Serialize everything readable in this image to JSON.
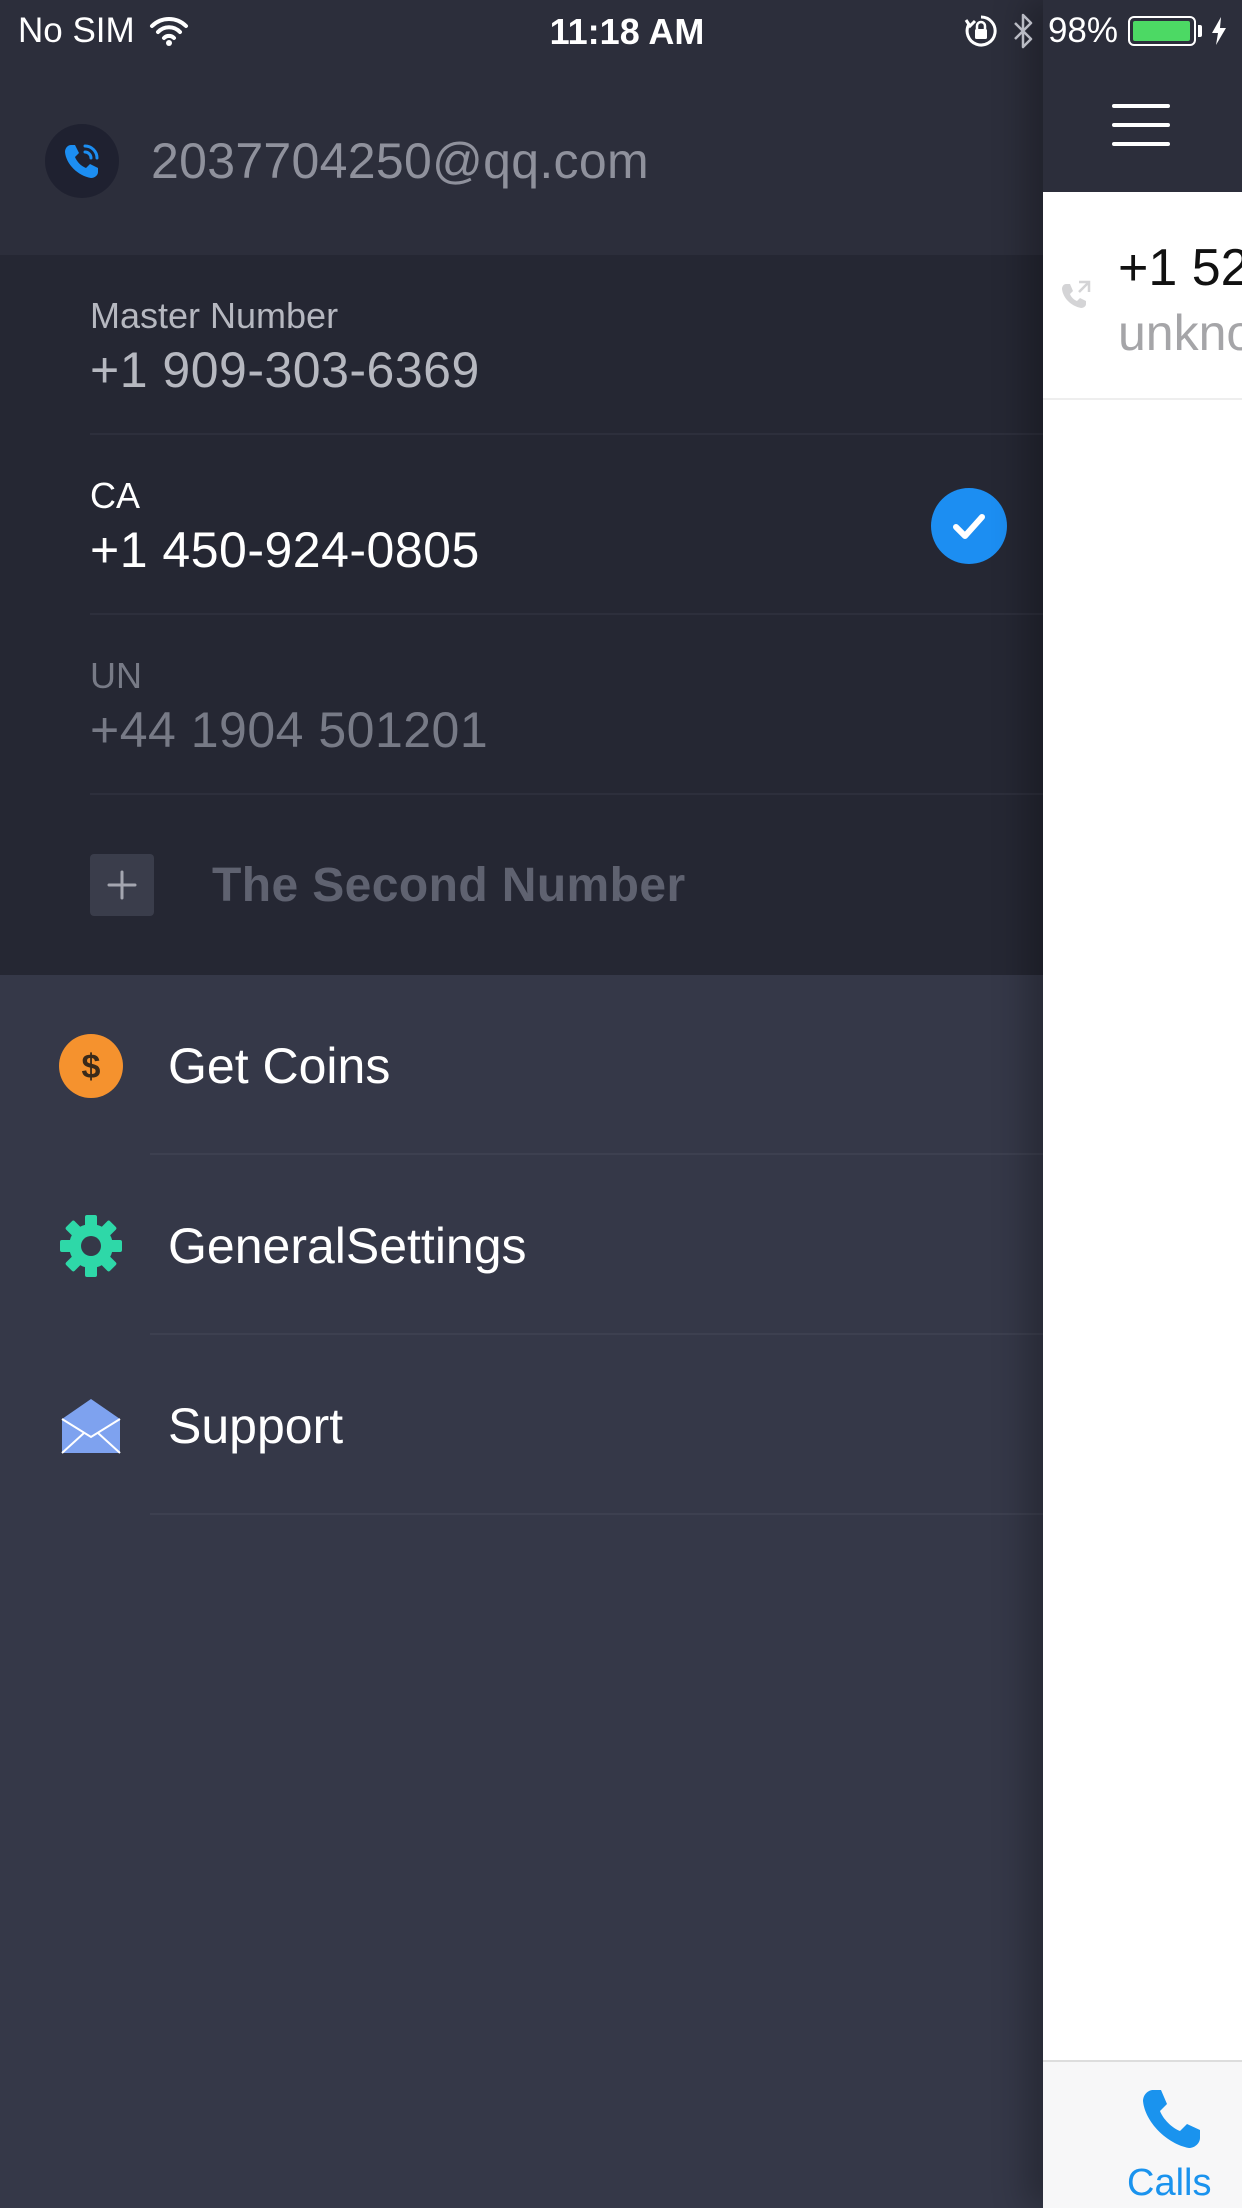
{
  "status_bar": {
    "carrier": "No SIM",
    "time": "11:18 AM",
    "battery_percent": "98%",
    "battery_level": 0.98,
    "icons": [
      "wifi-icon",
      "rotation-lock-icon",
      "bluetooth-icon",
      "battery-icon",
      "charging-bolt-icon"
    ]
  },
  "drawer": {
    "account": {
      "avatar_icon": "phone-waves-icon",
      "email": "2037704250@qq.com"
    },
    "numbers": [
      {
        "label": "Master Number",
        "value": "+1 909-303-6369",
        "selected": false
      },
      {
        "label": "CA",
        "value": "+1 450-924-0805",
        "selected": true
      },
      {
        "label": "UN",
        "value": "+44 1904 501201",
        "selected": false
      }
    ],
    "add_number": {
      "icon": "plus-icon",
      "label": "The Second Number"
    },
    "menu": [
      {
        "icon": "coin-icon",
        "label": "Get Coins",
        "icon_color": "#f5922e"
      },
      {
        "icon": "gear-icon",
        "label": "GeneralSettings",
        "icon_color": "#2ed8a8"
      },
      {
        "icon": "envelope-icon",
        "label": "Support",
        "icon_color": "#7ea2ef"
      }
    ]
  },
  "main": {
    "nav_icon": "hamburger-menu-icon",
    "calls": [
      {
        "number": "+1 52",
        "sub": "unkno",
        "icon": "outgoing-call-icon"
      }
    ],
    "tab_bar": {
      "active_tab": {
        "label": "Calls",
        "icon": "phone-icon"
      }
    }
  },
  "colors": {
    "drawer_bg": "#353848",
    "header_bg": "#2c2e3b",
    "numbers_bg": "#252733",
    "accent_blue": "#1c8ef2",
    "tab_blue": "#1a93ee"
  }
}
